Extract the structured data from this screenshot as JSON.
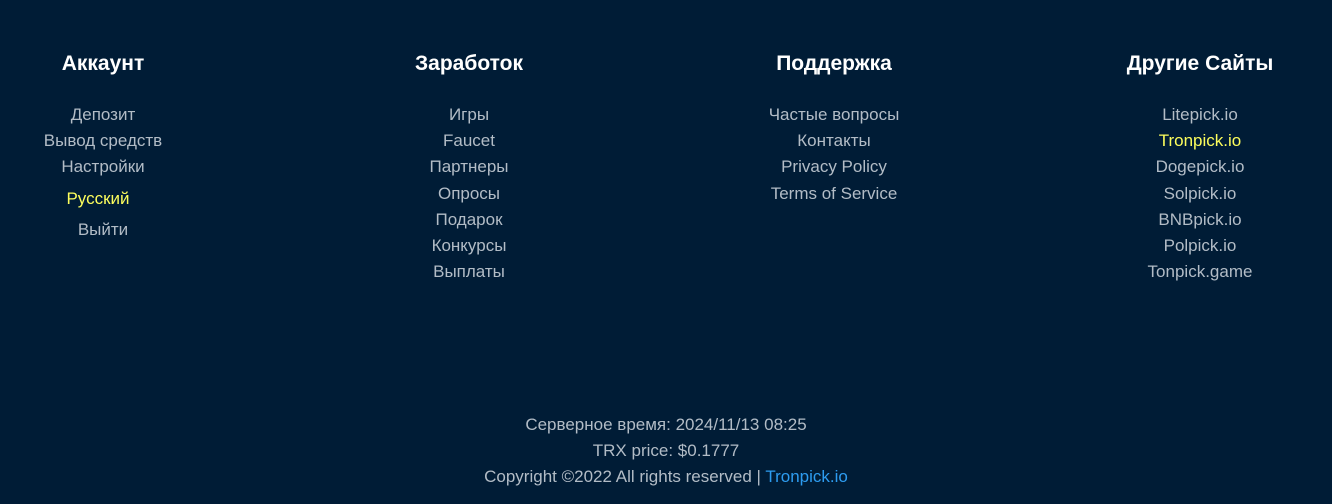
{
  "columns": {
    "account": {
      "title": "Аккаунт",
      "items": [
        "Депозит",
        "Вывод средств",
        "Настройки",
        "Русский",
        "Выйти"
      ]
    },
    "earnings": {
      "title": "Заработок",
      "items": [
        "Игры",
        "Faucet",
        "Партнеры",
        "Опросы",
        "Подарок",
        "Конкурсы",
        "Выплаты"
      ]
    },
    "support": {
      "title": "Поддержка",
      "items": [
        "Частые вопросы",
        "Контакты",
        "Privacy Policy",
        "Terms of Service"
      ]
    },
    "other_sites": {
      "title": "Другие Сайты",
      "items": [
        "Litepick.io",
        "Tronpick.io",
        "Dogepick.io",
        "Solpick.io",
        "BNBpick.io",
        "Polpick.io",
        "Tonpick.game"
      ]
    }
  },
  "bottom": {
    "server_time": "Серверное время: 2024/11/13 08:25",
    "price": "TRX price: $0.1777",
    "copyright": "Copyright ©2022 All rights reserved | ",
    "copyright_link": "Tronpick.io"
  },
  "colors": {
    "background": "#001c36",
    "text": "#b2bcc6",
    "heading": "#ffffff",
    "highlight": "#fcfd5c",
    "link": "#2d9cf0"
  }
}
